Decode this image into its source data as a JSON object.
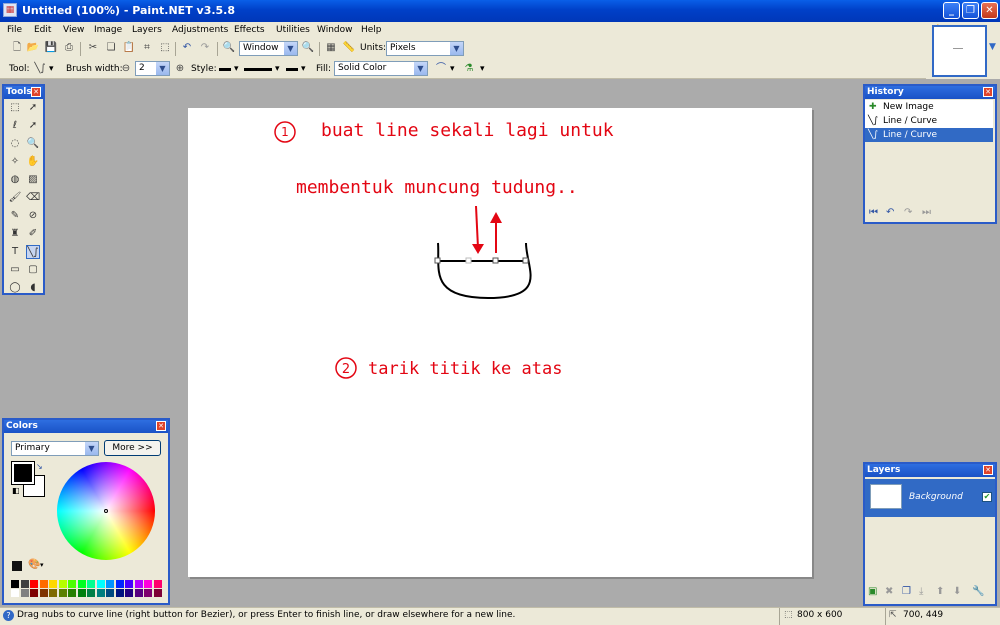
{
  "window": {
    "title": "Untitled (100%) - Paint.NET v3.5.8",
    "minimize_glyph": "_",
    "maximize_glyph": "❐",
    "close_glyph": "✕"
  },
  "menu": [
    "File",
    "Edit",
    "View",
    "Image",
    "Layers",
    "Adjustments",
    "Effects",
    "Utilities",
    "Window",
    "Help"
  ],
  "toolbar": {
    "zoom_value": "Window",
    "units_label": "Units:",
    "units_value": "Pixels",
    "tool_label": "Tool:",
    "brush_width_label": "Brush width:",
    "brush_width_value": "2",
    "style_label": "Style:",
    "fill_label": "Fill:",
    "fill_value": "Solid Color"
  },
  "canvas": {
    "annotation_num1": "1",
    "annotation_line1": "buat line sekali lagi untuk",
    "annotation_line2": "membentuk muncung tudung..",
    "annotation_num2": "2",
    "annotation_line3": "tarik titik ke atas",
    "annotation_color": "#e30613"
  },
  "tools_panel": {
    "title": "Tools"
  },
  "history_panel": {
    "title": "History",
    "items": [
      "New Image",
      "Line / Curve",
      "Line / Curve"
    ],
    "selected_index": 2
  },
  "colors_panel": {
    "title": "Colors",
    "mode_value": "Primary",
    "more_label": "More >>",
    "primary_color": "#000000",
    "secondary_color": "#ffffff"
  },
  "layers_panel": {
    "title": "Layers",
    "layer_name": "Background",
    "layer_visible": true
  },
  "statusbar": {
    "hint": "Drag nubs to curve line (right button for Bezier), or press Enter to finish line, or draw elsewhere for a new line.",
    "image_size": "800 x 600",
    "cursor_position": "700, 449"
  },
  "icons": [
    "app-icon",
    "new-icon",
    "open-icon",
    "save-icon",
    "print-icon",
    "cut-icon",
    "copy-icon",
    "paste-icon",
    "crop-icon",
    "deselect-icon",
    "undo-icon",
    "redo-icon",
    "zoom-out-icon",
    "zoom-in-icon",
    "grid-icon",
    "ruler-icon",
    "line-curve-icon",
    "zoom-icon",
    "antialias-icon",
    "blend-mode-icon",
    "help-icon"
  ],
  "palette": [
    "#000000",
    "#404040",
    "#ff0000",
    "#ff6a00",
    "#ffd800",
    "#b6ff00",
    "#4cff00",
    "#00ff21",
    "#00ff90",
    "#00ffff",
    "#0094ff",
    "#0026ff",
    "#4800ff",
    "#b200ff",
    "#ff00dc",
    "#ff006e",
    "#ffffff",
    "#808080",
    "#7f0000",
    "#7f3300",
    "#7f6a00",
    "#5b7f00",
    "#267f00",
    "#007f0e",
    "#007f46",
    "#007f7f",
    "#004a7f",
    "#00137f",
    "#21007f",
    "#57007f",
    "#7f006e",
    "#7f0037"
  ]
}
